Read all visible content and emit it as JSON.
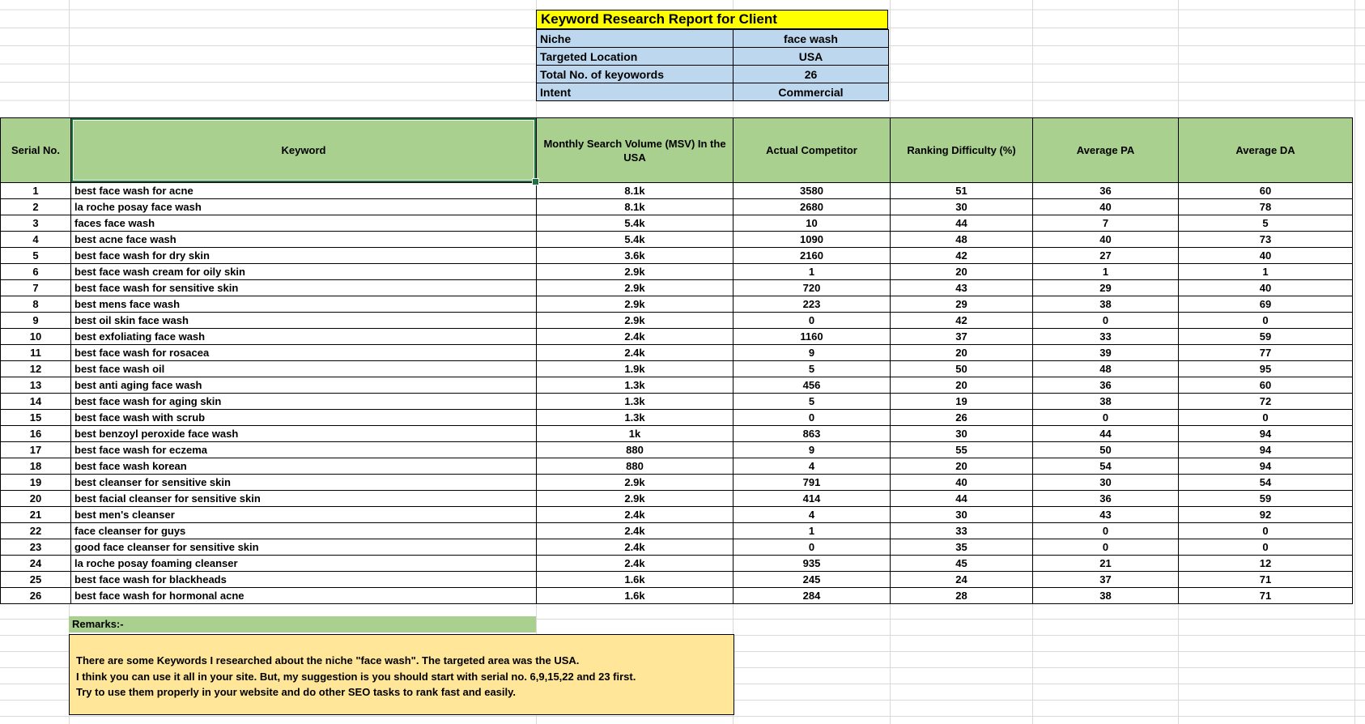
{
  "report": {
    "title": "Keyword Research Report for Client",
    "info": [
      {
        "label": "Niche",
        "value": "face wash"
      },
      {
        "label": "Targeted Location",
        "value": "USA"
      },
      {
        "label": "Total No. of keyowords",
        "value": "26"
      },
      {
        "label": "Intent",
        "value": "Commercial"
      }
    ]
  },
  "table": {
    "columns": [
      "Serial No.",
      "Keyword",
      "Monthly Search Volume (MSV) In the USA",
      "Actual Competitor",
      "Ranking Difficulty (%)",
      "Average PA",
      "Average DA"
    ],
    "rows": [
      {
        "sn": "1",
        "keyword": "best face wash for acne",
        "msv": "8.1k",
        "competitor": "3580",
        "difficulty": "51",
        "pa": "36",
        "da": "60"
      },
      {
        "sn": "2",
        "keyword": "la roche posay face wash",
        "msv": "8.1k",
        "competitor": "2680",
        "difficulty": "30",
        "pa": "40",
        "da": "78"
      },
      {
        "sn": "3",
        "keyword": "faces face wash",
        "msv": "5.4k",
        "competitor": "10",
        "difficulty": "44",
        "pa": "7",
        "da": "5"
      },
      {
        "sn": "4",
        "keyword": "best acne face wash",
        "msv": "5.4k",
        "competitor": "1090",
        "difficulty": "48",
        "pa": "40",
        "da": "73"
      },
      {
        "sn": "5",
        "keyword": "best face wash for dry skin",
        "msv": "3.6k",
        "competitor": "2160",
        "difficulty": "42",
        "pa": "27",
        "da": "40"
      },
      {
        "sn": "6",
        "keyword": "best face wash cream for oily skin",
        "msv": "2.9k",
        "competitor": "1",
        "difficulty": "20",
        "pa": "1",
        "da": "1"
      },
      {
        "sn": "7",
        "keyword": "best face wash for sensitive skin",
        "msv": "2.9k",
        "competitor": "720",
        "difficulty": "43",
        "pa": "29",
        "da": "40"
      },
      {
        "sn": "8",
        "keyword": "best mens face wash",
        "msv": "2.9k",
        "competitor": "223",
        "difficulty": "29",
        "pa": "38",
        "da": "69"
      },
      {
        "sn": "9",
        "keyword": "best oil skin face wash",
        "msv": "2.9k",
        "competitor": "0",
        "difficulty": "42",
        "pa": "0",
        "da": "0"
      },
      {
        "sn": "10",
        "keyword": "best exfoliating face wash",
        "msv": "2.4k",
        "competitor": "1160",
        "difficulty": "37",
        "pa": "33",
        "da": "59"
      },
      {
        "sn": "11",
        "keyword": "best face wash for rosacea",
        "msv": "2.4k",
        "competitor": "9",
        "difficulty": "20",
        "pa": "39",
        "da": "77"
      },
      {
        "sn": "12",
        "keyword": "best face wash oil",
        "msv": "1.9k",
        "competitor": "5",
        "difficulty": "50",
        "pa": "48",
        "da": "95"
      },
      {
        "sn": "13",
        "keyword": "best anti aging face wash",
        "msv": "1.3k",
        "competitor": "456",
        "difficulty": "20",
        "pa": "36",
        "da": "60"
      },
      {
        "sn": "14",
        "keyword": "best face wash for aging skin",
        "msv": "1.3k",
        "competitor": "5",
        "difficulty": "19",
        "pa": "38",
        "da": "72"
      },
      {
        "sn": "15",
        "keyword": "best face wash with scrub",
        "msv": "1.3k",
        "competitor": "0",
        "difficulty": "26",
        "pa": "0",
        "da": "0"
      },
      {
        "sn": "16",
        "keyword": "best benzoyl peroxide face wash",
        "msv": "1k",
        "competitor": "863",
        "difficulty": "30",
        "pa": "44",
        "da": "94"
      },
      {
        "sn": "17",
        "keyword": "best face wash for eczema",
        "msv": "880",
        "competitor": "9",
        "difficulty": "55",
        "pa": "50",
        "da": "94"
      },
      {
        "sn": "18",
        "keyword": "best face wash korean",
        "msv": "880",
        "competitor": "4",
        "difficulty": "20",
        "pa": "54",
        "da": "94"
      },
      {
        "sn": "19",
        "keyword": "best cleanser for sensitive skin",
        "msv": "2.9k",
        "competitor": "791",
        "difficulty": "40",
        "pa": "30",
        "da": "54"
      },
      {
        "sn": "20",
        "keyword": "best facial cleanser for sensitive skin",
        "msv": "2.9k",
        "competitor": "414",
        "difficulty": "44",
        "pa": "36",
        "da": "59"
      },
      {
        "sn": "21",
        "keyword": "best men's cleanser",
        "msv": "2.4k",
        "competitor": "4",
        "difficulty": "30",
        "pa": "43",
        "da": "92"
      },
      {
        "sn": "22",
        "keyword": "face cleanser for guys",
        "msv": "2.4k",
        "competitor": "1",
        "difficulty": "33",
        "pa": "0",
        "da": "0"
      },
      {
        "sn": "23",
        "keyword": "good face cleanser for sensitive skin",
        "msv": "2.4k",
        "competitor": "0",
        "difficulty": "35",
        "pa": "0",
        "da": "0"
      },
      {
        "sn": "24",
        "keyword": "la roche posay foaming cleanser",
        "msv": "2.4k",
        "competitor": "935",
        "difficulty": "45",
        "pa": "21",
        "da": "12"
      },
      {
        "sn": "25",
        "keyword": "best face wash for blackheads",
        "msv": "1.6k",
        "competitor": "245",
        "difficulty": "24",
        "pa": "37",
        "da": "71"
      },
      {
        "sn": "26",
        "keyword": "best face wash for hormonal acne",
        "msv": "1.6k",
        "competitor": "284",
        "difficulty": "28",
        "pa": "38",
        "da": "71"
      }
    ]
  },
  "remarks": {
    "label": "Remarks:-",
    "lines": [
      "There are some Keywords I researched about the niche \"face wash\". The targeted area was the USA.",
      "I think you can use it all in your site. But, my suggestion is you should start with serial no. 6,9,15,22 and 23 first.",
      "Try to use them properly in your website and do other SEO tasks to rank fast and easily."
    ]
  },
  "colors": {
    "title_bg": "#FFFF00",
    "info_bg": "#BDD7EE",
    "header_bg": "#A9D08E",
    "remarks_bg": "#A9D08E",
    "notes_bg": "#FFE699",
    "selection_border": "#217346",
    "gridline": "#D9D9D9"
  }
}
